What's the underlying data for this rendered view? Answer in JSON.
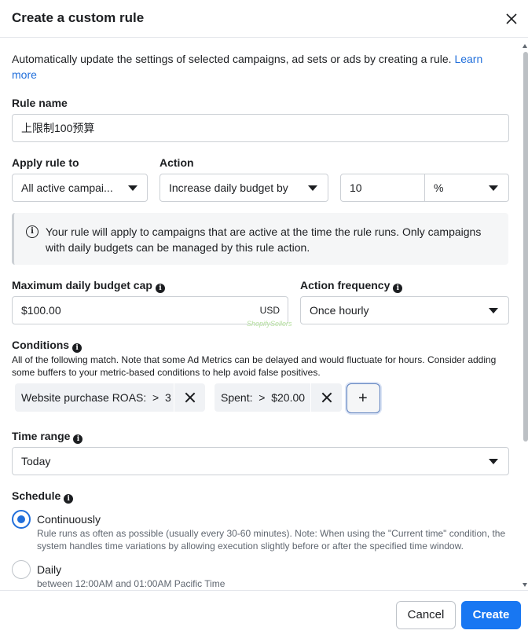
{
  "dialog": {
    "title": "Create a custom rule",
    "close_icon": "close-icon"
  },
  "intro": {
    "text": "Automatically update the settings of selected campaigns, ad sets or ads by creating a rule. ",
    "link": "Learn more"
  },
  "rule_name": {
    "label": "Rule name",
    "value": "上限制100预算"
  },
  "apply_rule": {
    "label": "Apply rule to",
    "value": "All active campai..."
  },
  "action": {
    "label": "Action",
    "value": "Increase daily budget by",
    "amount": "10",
    "unit": "%"
  },
  "notice": {
    "icon": "info-icon",
    "text": "Your rule will apply to campaigns that are active at the time the rule runs. Only campaigns with daily budgets can be managed by this rule action."
  },
  "budget_cap": {
    "label": "Maximum daily budget cap",
    "value": "$100.00",
    "currency": "USD"
  },
  "frequency": {
    "label": "Action frequency",
    "value": "Once hourly"
  },
  "watermark": "ShopifySellers",
  "conditions": {
    "label": "Conditions",
    "description": "All of the following match. Note that some Ad Metrics can be delayed and would fluctuate for hours. Consider adding some buffers to your metric-based conditions to help avoid false positives.",
    "items": [
      {
        "metric": "Website purchase ROAS:",
        "operator": ">",
        "value": "3"
      },
      {
        "metric": "Spent:",
        "operator": ">",
        "value": "$20.00"
      }
    ],
    "add_label": "+"
  },
  "time_range": {
    "label": "Time range",
    "value": "Today"
  },
  "schedule": {
    "label": "Schedule",
    "options": [
      {
        "title": "Continuously",
        "description": "Rule runs as often as possible (usually every 30-60 minutes). Note: When using the \"Current time\" condition, the system handles time variations by allowing execution slightly before or after the specified time window.",
        "selected": true
      },
      {
        "title": "Daily",
        "description": "between 12:00AM and 01:00AM Pacific Time",
        "selected": false
      }
    ]
  },
  "footer": {
    "cancel": "Cancel",
    "create": "Create"
  },
  "colors": {
    "primary": "#1877f2",
    "link": "#216fdb",
    "border": "#ccd0d5",
    "chip_bg": "#f0f2f5"
  }
}
